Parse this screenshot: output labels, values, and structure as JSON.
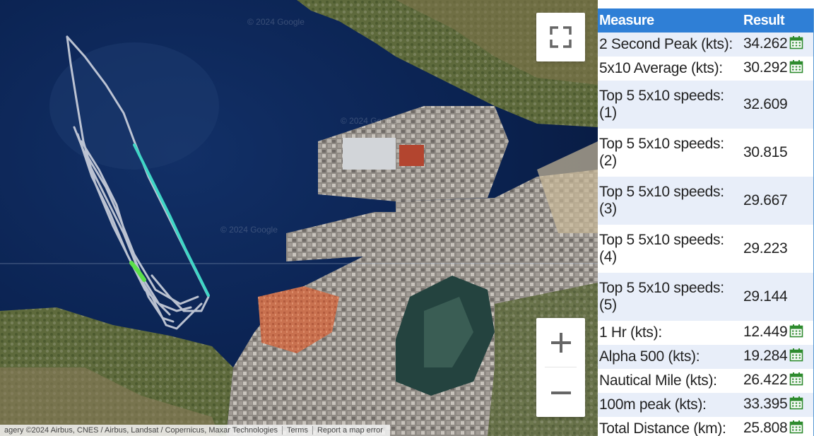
{
  "map": {
    "watermark": "© 2024 Google",
    "attribution": {
      "imagery": "agery ©2024 Airbus, CNES / Airbus, Landsat / Copernicus, Maxar Technologies",
      "terms": "Terms",
      "report": "Report a map error"
    },
    "controls": {
      "fullscreen_icon": "fullscreen-icon",
      "zoom_in": "+",
      "zoom_out": "−"
    },
    "colors": {
      "sea_deep": "#0c2350",
      "track": "#d9dde6",
      "fast_segment": "#3fd6c6",
      "peak_segment": "#5ce04a"
    }
  },
  "table": {
    "headers": {
      "measure": "Measure",
      "result": "Result"
    },
    "header_color": "#2f7fd6",
    "rows": [
      {
        "measure": "2 Second Peak (kts):",
        "result": "34.262",
        "calendar": true
      },
      {
        "measure": "5x10 Average (kts):",
        "result": "30.292",
        "calendar": true
      },
      {
        "measure": "Top 5 5x10 speeds: (1)",
        "result": "32.609",
        "calendar": false
      },
      {
        "measure": "Top 5 5x10 speeds: (2)",
        "result": "30.815",
        "calendar": false
      },
      {
        "measure": "Top 5 5x10 speeds: (3)",
        "result": "29.667",
        "calendar": false
      },
      {
        "measure": "Top 5 5x10 speeds: (4)",
        "result": "29.223",
        "calendar": false
      },
      {
        "measure": "Top 5 5x10 speeds: (5)",
        "result": "29.144",
        "calendar": false
      },
      {
        "measure": "1 Hr (kts):",
        "result": "12.449",
        "calendar": true
      },
      {
        "measure": "Alpha 500 (kts):",
        "result": "19.284",
        "calendar": true
      },
      {
        "measure": "Nautical Mile (kts):",
        "result": "26.422",
        "calendar": true
      },
      {
        "measure": "100m peak (kts):",
        "result": "33.395",
        "calendar": true
      },
      {
        "measure": "Total Distance (km):",
        "result": "25.808",
        "calendar": true
      }
    ]
  }
}
